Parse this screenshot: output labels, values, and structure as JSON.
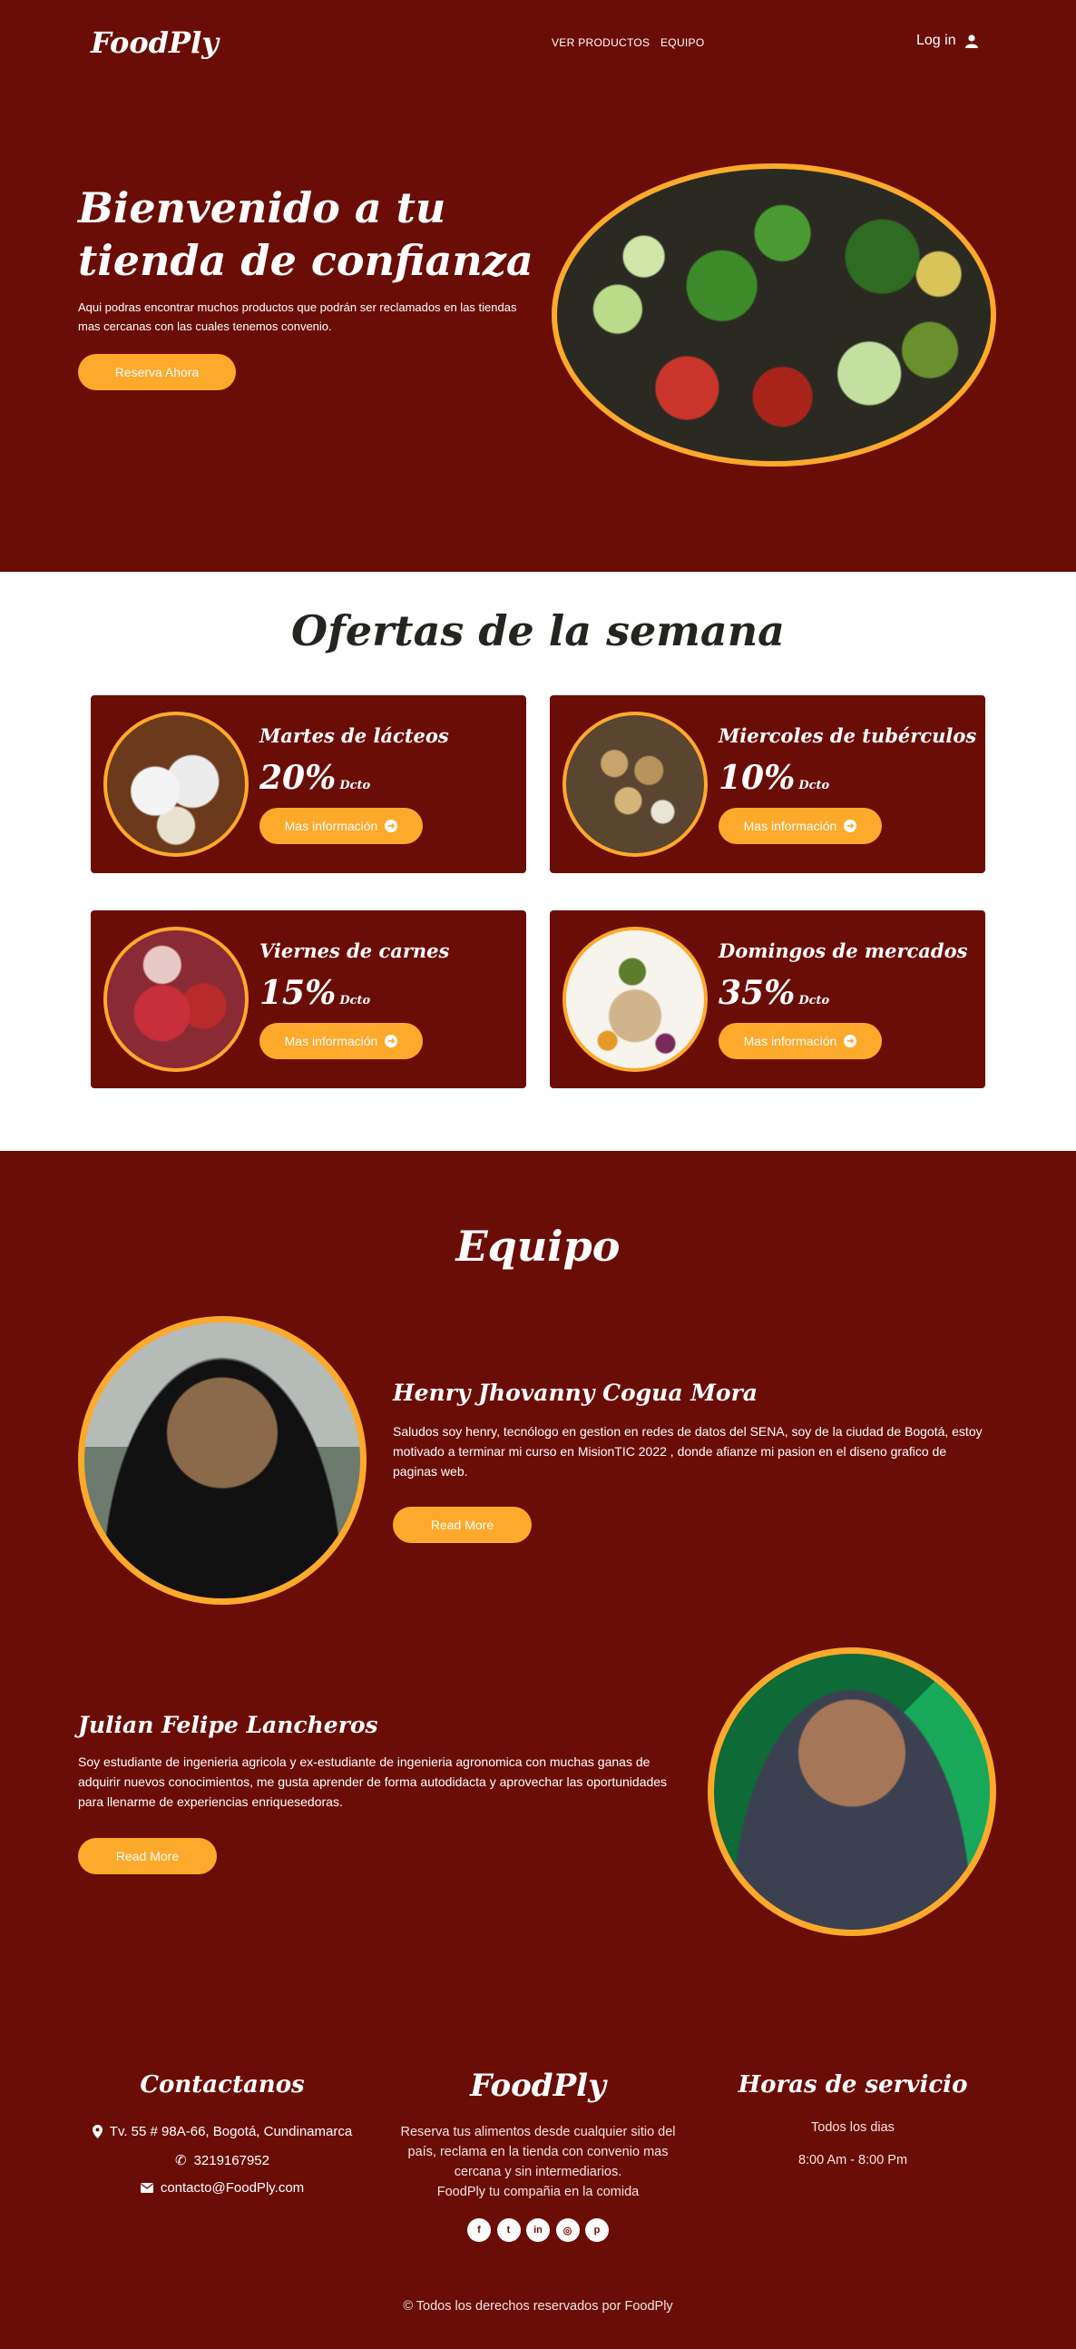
{
  "nav": {
    "brand": "FoodPly",
    "links": [
      "VER PRODUCTOS",
      "EQUIPO"
    ],
    "login_label": "Log in",
    "login_icon": "user-icon"
  },
  "hero": {
    "title": "Bienvenido a tu tienda de confianza",
    "text": "Aqui podras encontrar muchos productos que podrán ser reclamados en las tiendas mas cercanas con las cuales tenemos convenio.",
    "button": "Reserva Ahora",
    "image_subject": "vegetables"
  },
  "offers": {
    "title": "Ofertas de la semana",
    "cards": [
      {
        "title": "Martes de lácteos",
        "percent": "20%",
        "suffix": "Dcto",
        "button": "Mas información",
        "icon": "arrow-right-circle-icon"
      },
      {
        "title": "Miercoles de tubérculos",
        "percent": "10%",
        "suffix": "Dcto",
        "button": "Mas información",
        "icon": "arrow-right-circle-icon"
      },
      {
        "title": "Viernes de carnes",
        "percent": "15%",
        "suffix": "Dcto",
        "button": "Mas información",
        "icon": "arrow-right-circle-icon"
      },
      {
        "title": "Domingos de mercados",
        "percent": "35%",
        "suffix": "Dcto",
        "button": "Mas información",
        "icon": "arrow-right-circle-icon"
      }
    ]
  },
  "team": {
    "title": "Equipo",
    "members": [
      {
        "name": "Henry Jhovanny Cogua Mora",
        "bio": "Saludos soy henry, tecnólogo en gestion en redes de datos del SENA, soy de la ciudad de Bogotá, estoy motivado a terminar mi curso en MisionTIC 2022 , donde afianze mi pasion en el diseno grafico de paginas web.",
        "button": "Read More"
      },
      {
        "name": "Julian Felipe Lancheros",
        "bio": "Soy estudiante de ingenieria agricola y ex-estudiante de ingenieria agronomica con muchas ganas de adquirir nuevos conocimientos, me gusta aprender de forma autodidacta y aprovechar las oportunidades para llenarme de experiencias enriquesedoras.",
        "button": "Read More"
      }
    ]
  },
  "footer": {
    "contact_title": "Contactanos",
    "address": "Tv. 55 # 98A-66, Bogotá, Cundinamarca",
    "phone": "3219167952",
    "email": "contacto@FoodPly.com",
    "brand": "FoodPly",
    "description": "Reserva tus alimentos desde cualquier sitio del país, reclama en la tienda con convenio mas cercana y sin intermediarios.",
    "tagline": "FoodPly tu compañia en la comida",
    "hours_title": "Horas de servicio",
    "days": "Todos los dias",
    "time": "8:00 Am - 8:00 Pm",
    "socials": [
      "facebook-icon",
      "twitter-icon",
      "linkedin-icon",
      "instagram-icon",
      "pinterest-icon"
    ],
    "copyright": "© Todos los derechos reservados por FoodPly"
  },
  "colors": {
    "primary": "#6b0d07",
    "accent": "#fda92b",
    "text_dark": "#262420"
  }
}
